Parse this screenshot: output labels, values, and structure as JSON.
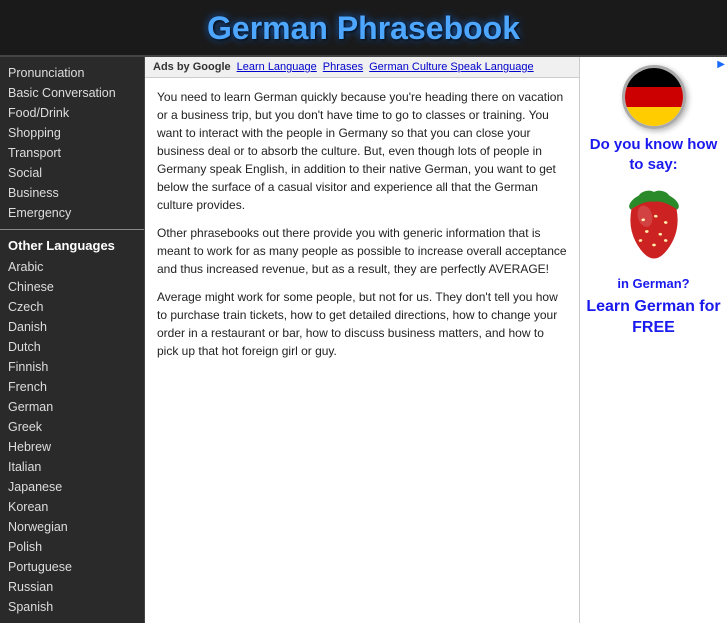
{
  "header": {
    "title": "German Phrasebook"
  },
  "sidebar": {
    "main_items": [
      "Pronunciation",
      "Basic Conversation",
      "Food/Drink",
      "Shopping",
      "Transport",
      "Social",
      "Business",
      "Emergency"
    ],
    "other_languages_title": "Other Languages",
    "language_items": [
      "Arabic",
      "Chinese",
      "Czech",
      "Danish",
      "Dutch",
      "Finnish",
      "French",
      "German",
      "Greek",
      "Hebrew",
      "Italian",
      "Japanese",
      "Korean",
      "Norwegian",
      "Polish",
      "Portuguese",
      "Russian",
      "Spanish"
    ]
  },
  "ads_bar": {
    "ads_label": "Ads by Google",
    "links": [
      "Learn Language",
      "Phrases",
      "German Culture Speak Language"
    ]
  },
  "content": {
    "paragraphs": [
      "You need to learn German quickly because you're heading there on vacation or a business trip, but you don't have time to go to classes or training. You want to interact with the people in Germany so that you can close your business deal or to absorb the culture. But, even though lots of people in Germany speak English, in addition to their native German, you want to get below the surface of a casual visitor and experience all that the German culture provides.",
      "Other phrasebooks out there provide you with generic information that is meant to work for as many people as possible to increase overall acceptance and thus increased revenue, but as a result, they are perfectly AVERAGE!",
      "Average might work for some people, but not for us. They don't tell you how to purchase train tickets, how to get detailed directions, how to change your order in a restaurant or bar, how to discuss business matters, and how to pick up that hot foreign girl or guy."
    ]
  },
  "right_ad": {
    "question": "Do you know how to say:",
    "in_german": "in German?",
    "learn_label": "Learn German for FREE"
  }
}
